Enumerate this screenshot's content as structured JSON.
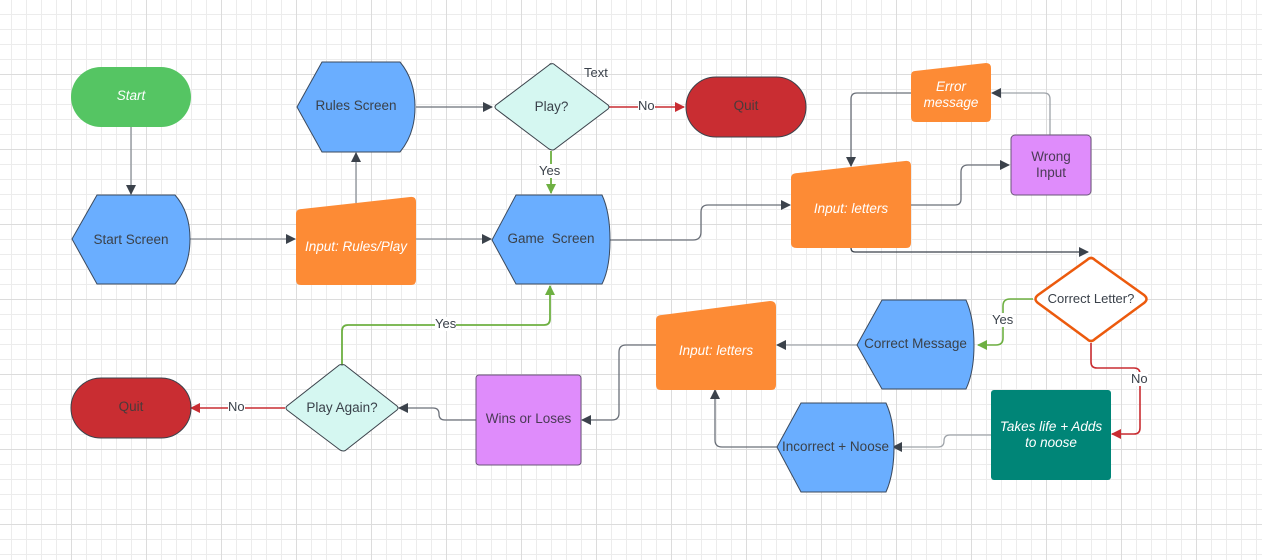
{
  "diagram": {
    "type": "flowchart",
    "colors": {
      "terminator_green": "#55c563",
      "terminator_red": "#c92d32",
      "display_blue": "#6aaeff",
      "manual_input_orange": "#fd8b35",
      "process_purple": "#df8cfb",
      "decision_mint": "#d5f7f1",
      "process_teal": "#008577",
      "decision_outline_orange": "#ec5a0d",
      "edge_gray": "#3b424b",
      "edge_green": "#6eb042",
      "edge_red": "#c92d32"
    },
    "nodes": [
      {
        "id": "start",
        "label": "Start",
        "shape": "terminator",
        "color": "terminator_green"
      },
      {
        "id": "start_screen",
        "label": "Start Screen",
        "shape": "display",
        "color": "display_blue"
      },
      {
        "id": "input_rules_play",
        "label": "Input: Rules/Play",
        "shape": "manual-input",
        "color": "manual_input_orange"
      },
      {
        "id": "rules_screen",
        "label": "Rules Screen",
        "shape": "display",
        "color": "display_blue"
      },
      {
        "id": "play_decision",
        "label": "Play?",
        "shape": "decision",
        "color": "decision_mint"
      },
      {
        "id": "quit_top",
        "label": "Quit",
        "shape": "terminator",
        "color": "terminator_red"
      },
      {
        "id": "game_screen",
        "label": "Game  Screen",
        "shape": "display",
        "color": "display_blue"
      },
      {
        "id": "input_letters_top",
        "label": "Input: letters",
        "shape": "manual-input",
        "color": "manual_input_orange"
      },
      {
        "id": "error_message",
        "label": "Error message",
        "shape": "manual-input",
        "color": "manual_input_orange"
      },
      {
        "id": "wrong_input",
        "label": "Wrong Input",
        "shape": "process",
        "color": "process_purple"
      },
      {
        "id": "correct_letter",
        "label": "Correct Letter?",
        "shape": "decision",
        "color": "decision_outline"
      },
      {
        "id": "correct_message",
        "label": "Correct Message",
        "shape": "display",
        "color": "display_blue"
      },
      {
        "id": "takes_life",
        "label": "Takes life + Adds to noose",
        "shape": "process",
        "color": "process_teal"
      },
      {
        "id": "incorrect_noose",
        "label": "Incorrect + Noose",
        "shape": "display",
        "color": "display_blue"
      },
      {
        "id": "input_letters_bottom",
        "label": "Input: letters",
        "shape": "manual-input",
        "color": "manual_input_orange"
      },
      {
        "id": "wins_loses",
        "label": "Wins or Loses",
        "shape": "process",
        "color": "process_purple"
      },
      {
        "id": "play_again",
        "label": "Play Again?",
        "shape": "decision",
        "color": "decision_mint"
      },
      {
        "id": "quit_bottom",
        "label": "Quit",
        "shape": "terminator",
        "color": "terminator_red"
      }
    ],
    "edges": [
      {
        "from": "start",
        "to": "start_screen",
        "label": "",
        "color": "edge_gray"
      },
      {
        "from": "start_screen",
        "to": "input_rules_play",
        "label": "",
        "color": "edge_gray"
      },
      {
        "from": "input_rules_play",
        "to": "rules_screen",
        "label": "",
        "color": "edge_gray"
      },
      {
        "from": "input_rules_play",
        "to": "game_screen",
        "label": "",
        "color": "edge_gray"
      },
      {
        "from": "rules_screen",
        "to": "play_decision",
        "label": "",
        "color": "edge_gray"
      },
      {
        "from": "play_decision",
        "to": "quit_top",
        "label": "No",
        "color": "edge_red"
      },
      {
        "from": "play_decision",
        "to": "game_screen",
        "label": "Yes",
        "color": "edge_green"
      },
      {
        "from": "game_screen",
        "to": "input_letters_top",
        "label": "",
        "color": "edge_gray"
      },
      {
        "from": "input_letters_top",
        "to": "wrong_input",
        "label": "",
        "color": "edge_gray"
      },
      {
        "from": "wrong_input",
        "to": "error_message",
        "label": "",
        "color": "edge_gray"
      },
      {
        "from": "error_message",
        "to": "input_letters_top",
        "label": "",
        "color": "edge_gray"
      },
      {
        "from": "input_letters_top",
        "to": "correct_letter",
        "label": "",
        "color": "edge_gray"
      },
      {
        "from": "correct_letter",
        "to": "correct_message",
        "label": "Yes",
        "color": "edge_green"
      },
      {
        "from": "correct_letter",
        "to": "takes_life",
        "label": "No",
        "color": "edge_red"
      },
      {
        "from": "correct_message",
        "to": "input_letters_bottom",
        "label": "",
        "color": "edge_gray"
      },
      {
        "from": "takes_life",
        "to": "incorrect_noose",
        "label": "",
        "color": "edge_gray"
      },
      {
        "from": "incorrect_noose",
        "to": "input_letters_bottom",
        "label": "",
        "color": "edge_gray"
      },
      {
        "from": "input_letters_bottom",
        "to": "wins_loses",
        "label": "",
        "color": "edge_gray"
      },
      {
        "from": "wins_loses",
        "to": "play_again",
        "label": "",
        "color": "edge_gray"
      },
      {
        "from": "play_again",
        "to": "quit_bottom",
        "label": "No",
        "color": "edge_red"
      },
      {
        "from": "play_again",
        "to": "game_screen",
        "label": "Yes",
        "color": "edge_green"
      }
    ],
    "free_text": [
      "Text"
    ]
  },
  "labels": {
    "start": "Start",
    "start_screen": "Start Screen",
    "input_rules_play": "Input: Rules/Play",
    "rules_screen": "Rules Screen",
    "play_decision": "Play?",
    "quit_top": "Quit",
    "game_screen": "Game  Screen",
    "input_letters_top": "Input: letters",
    "error_message": "Error message",
    "wrong_input": "Wrong Input",
    "correct_letter": "Correct Letter?",
    "correct_message": "Correct Message",
    "takes_life": "Takes life + Adds to noose",
    "incorrect_noose": "Incorrect + Noose",
    "input_letters_bottom": "Input: letters",
    "wins_loses": "Wins or Loses",
    "play_again": "Play Again?",
    "quit_bottom": "Quit",
    "free_text": "Text",
    "edge_play_no": "No",
    "edge_play_yes": "Yes",
    "edge_correct_yes": "Yes",
    "edge_correct_no": "No",
    "edge_again_no": "No",
    "edge_again_yes": "Yes"
  }
}
